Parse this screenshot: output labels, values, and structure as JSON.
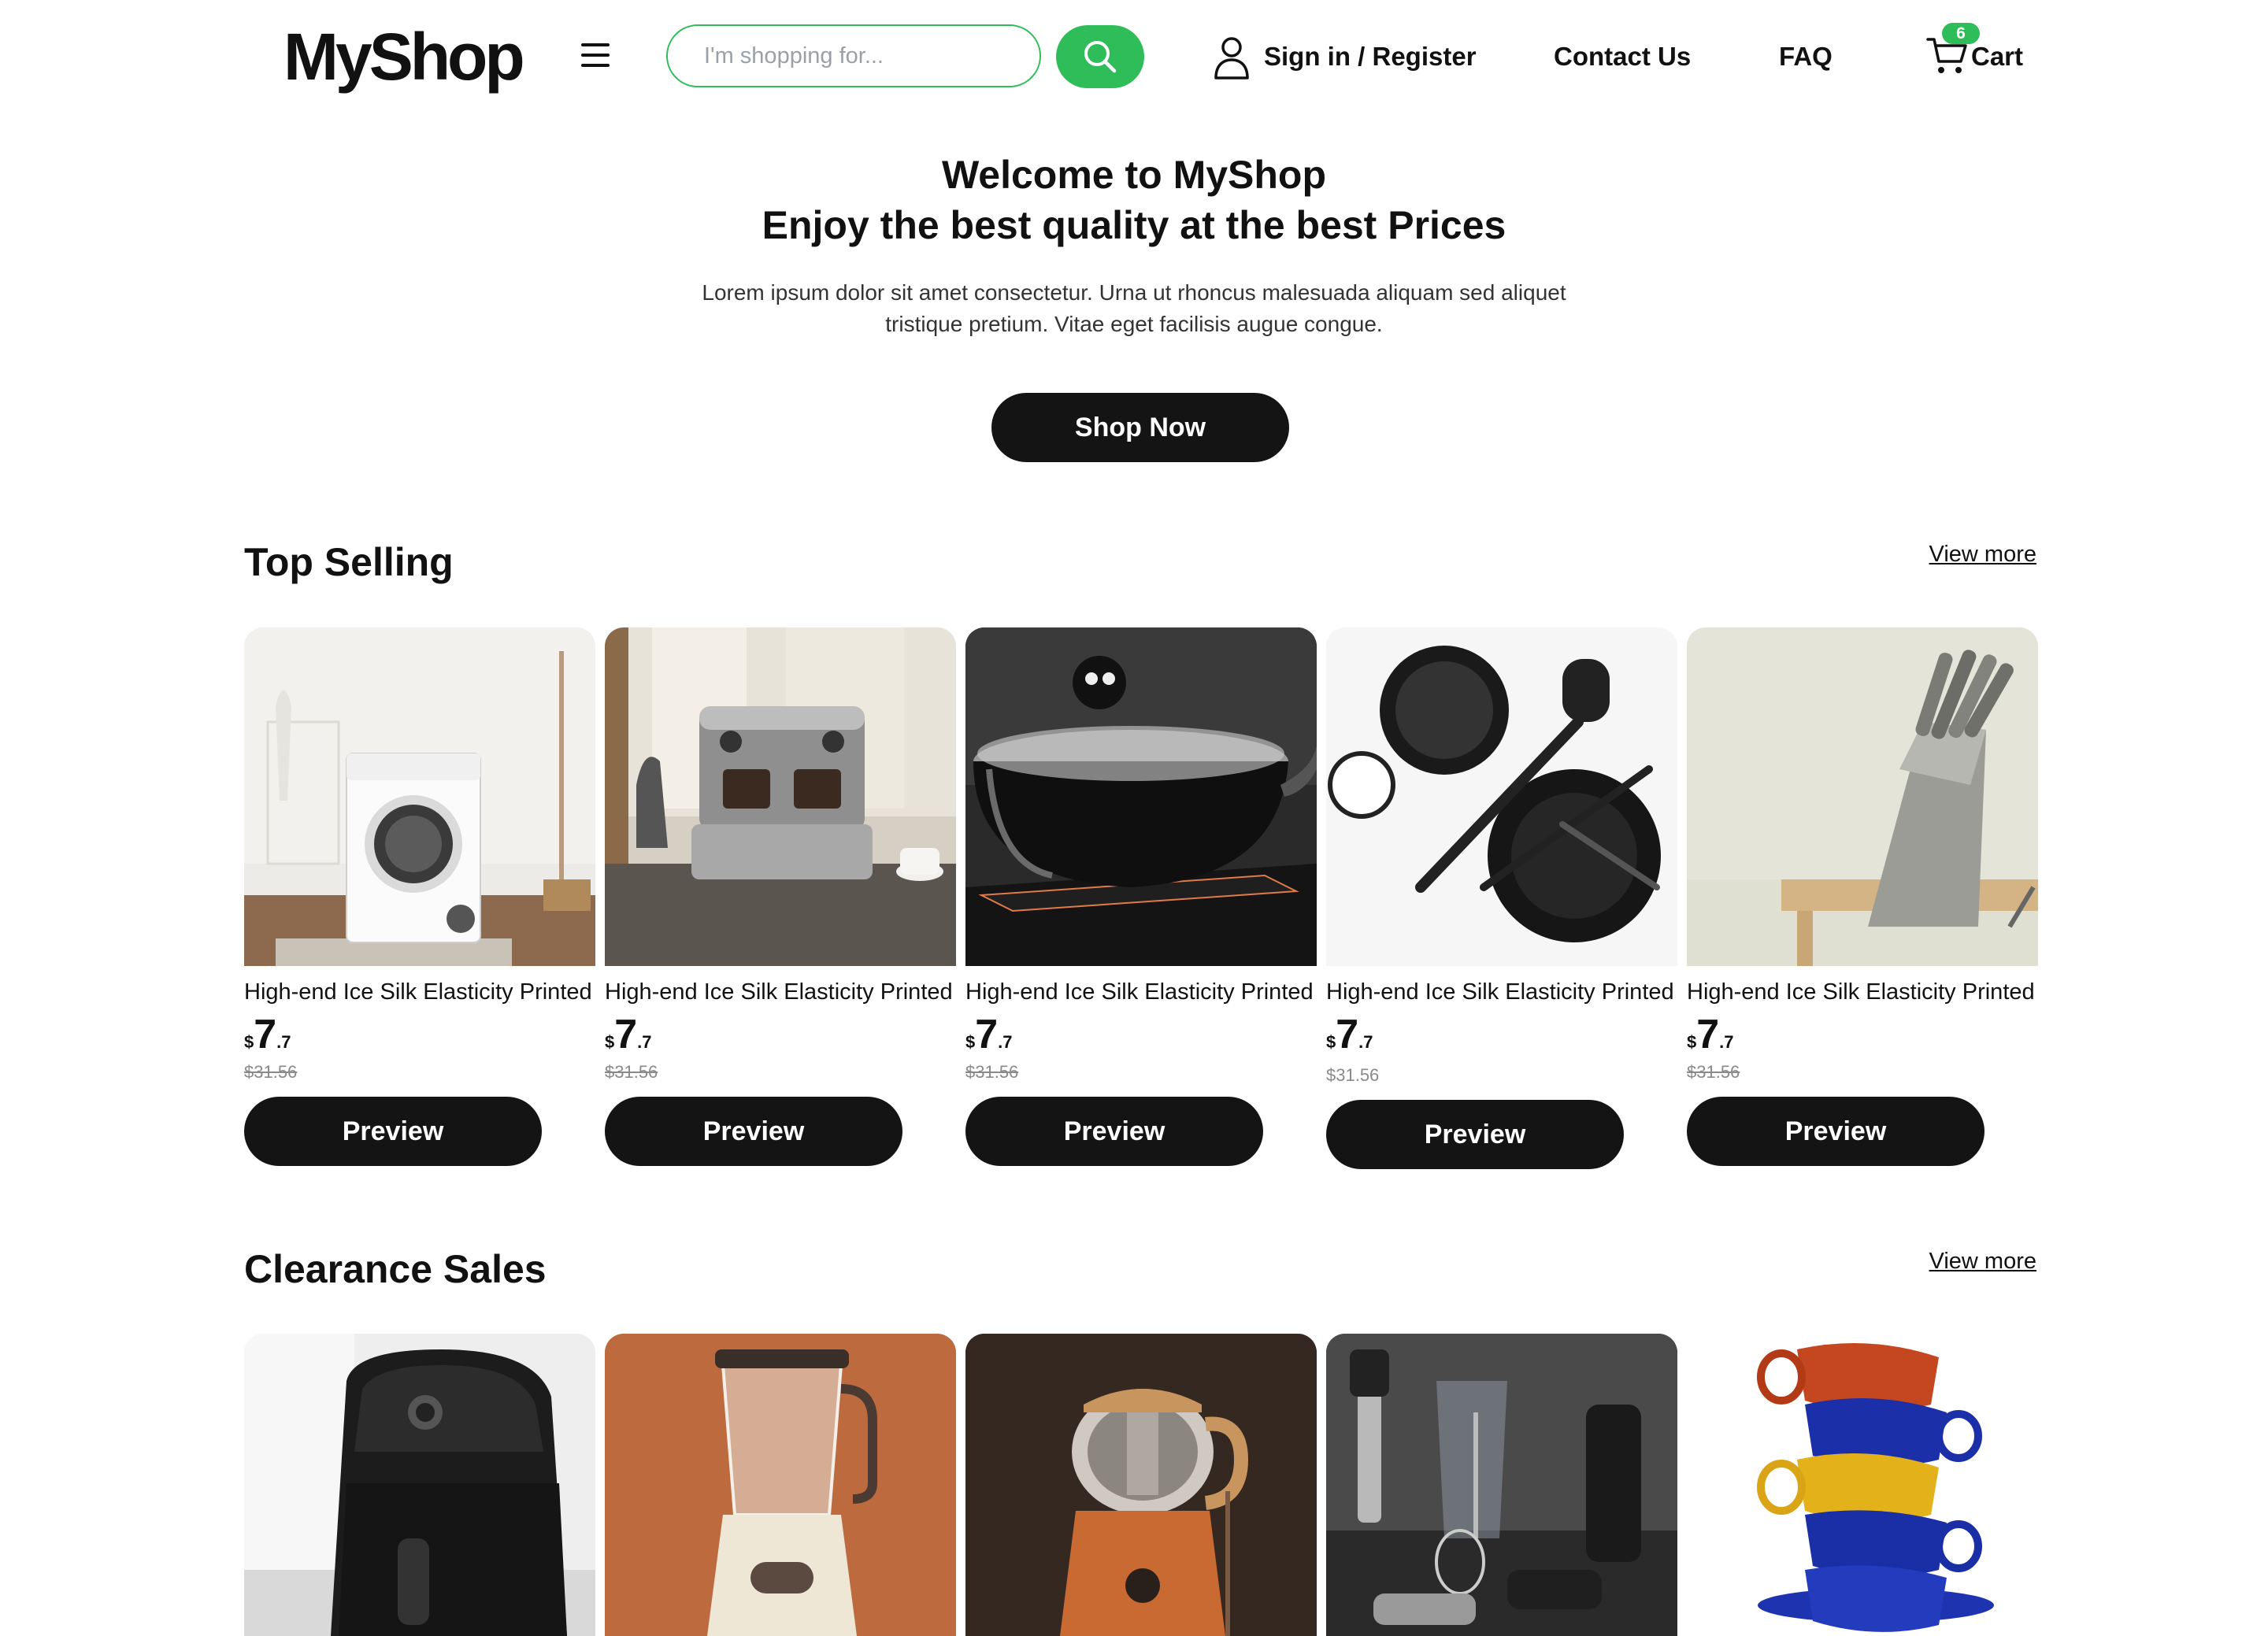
{
  "header": {
    "logo": "MyShop",
    "search_placeholder": "I'm shopping for...",
    "signin": "Sign in / Register",
    "contact": "Contact Us",
    "faq": "FAQ",
    "cart_label": "Cart",
    "cart_count": "6"
  },
  "hero": {
    "title": "Welcome to MyShop",
    "subtitle": "Enjoy the best quality at the best Prices",
    "description": "Lorem ipsum dolor sit amet consectetur. Urna ut rhoncus malesuada aliquam sed aliquet tristique pretium. Vitae eget facilisis augue congue.",
    "cta": "Shop Now"
  },
  "top_selling": {
    "title": "Top Selling",
    "view_more": "View more",
    "products": [
      {
        "name": "High-end Ice Silk Elasticity Printed",
        "currency": "$",
        "price_int": "7",
        "price_dec": ".7",
        "old_price": "$31.56",
        "button": "Preview",
        "image": "washing-machine"
      },
      {
        "name": "High-end Ice Silk Elasticity Printed",
        "currency": "$",
        "price_int": "7",
        "price_dec": ".7",
        "old_price": "$31.56",
        "button": "Preview",
        "image": "espresso-machine"
      },
      {
        "name": "High-end Ice Silk Elasticity Printed",
        "currency": "$",
        "price_int": "7",
        "price_dec": ".7",
        "old_price": "$31.56",
        "button": "Preview",
        "image": "cooking-pot"
      },
      {
        "name": "High-end Ice Silk Elasticity Printed",
        "currency": "$",
        "price_int": "7",
        "price_dec": ".7",
        "old_price": "$31.56",
        "button": "Preview",
        "image": "kitchen-utensils"
      },
      {
        "name": "High-end Ice Silk Elasticity Printed",
        "currency": "$",
        "price_int": "7",
        "price_dec": ".7",
        "old_price": "$31.56",
        "button": "Preview",
        "image": "knife-block"
      }
    ]
  },
  "clearance": {
    "title": "Clearance Sales",
    "view_more": "View more",
    "products": [
      {
        "image": "air-fryer"
      },
      {
        "image": "blender"
      },
      {
        "image": "coffee-maker"
      },
      {
        "image": "hand-blender"
      },
      {
        "image": "stacked-cups"
      }
    ]
  },
  "colors": {
    "accent": "#2ebd59",
    "button_dark": "#141414"
  }
}
